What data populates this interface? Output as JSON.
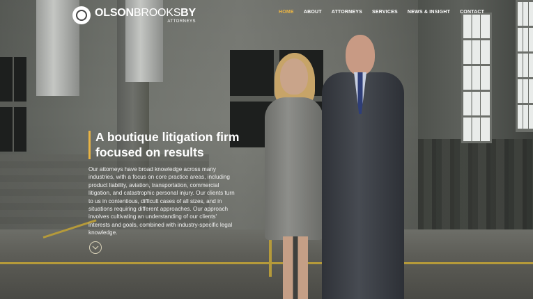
{
  "brand": {
    "name_bold_1": "OLSON",
    "name_light": "BROOKS",
    "name_bold_2": "BY",
    "subtitle": "ATTORNEYS"
  },
  "nav": {
    "items": [
      "HOME",
      "ABOUT",
      "ATTORNEYS",
      "SERVICES",
      "NEWS & INSIGHT",
      "CONTACT"
    ],
    "active": "HOME"
  },
  "hero": {
    "title": "A boutique litigation firm focused on results",
    "body": "Our attorneys have broad knowledge across many industries, with a focus on core practice areas, including product liability, aviation, transportation, commercial litigation, and catastrophic personal injury.  Our clients turn to us in contentious, difficult cases of all sizes, and in situations requiring different approaches.  Our approach involves cultivating an understanding of our clients' interests and goals, combined with industry-specific legal knowledge."
  },
  "icons": {
    "logo": "circle-logo-icon",
    "scroll": "chevron-down-icon"
  },
  "colors": {
    "accent": "#e9b444",
    "text": "#ffffff"
  }
}
